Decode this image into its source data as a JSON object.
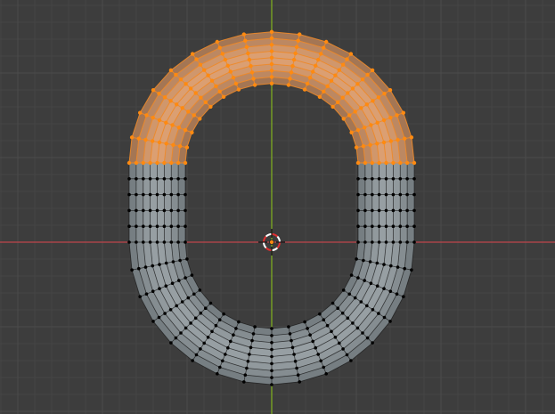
{
  "viewport": {
    "mode": "edit-mode-vertex-select",
    "view": "top-orthographic"
  },
  "colors": {
    "background": "#3d3d3d",
    "grid_minor": "#454545",
    "grid_major": "#4b4b4b",
    "axis_x": "#c0454b",
    "axis_y": "#82b41e",
    "mesh_face_unselected": "#8f979c",
    "mesh_face_selected": "#d29a70",
    "edge_unselected": "#141414",
    "edge_selected": "#f08a28",
    "vertex_unselected": "#000000",
    "vertex_selected": "#ff8a10",
    "cursor_ring_red": "#e03030",
    "cursor_ring_white": "#ffffff"
  },
  "mesh": {
    "name": "torus-like-loop",
    "selection": "upper-half-selected"
  },
  "icons": {
    "cursor": "3d-cursor-icon"
  }
}
